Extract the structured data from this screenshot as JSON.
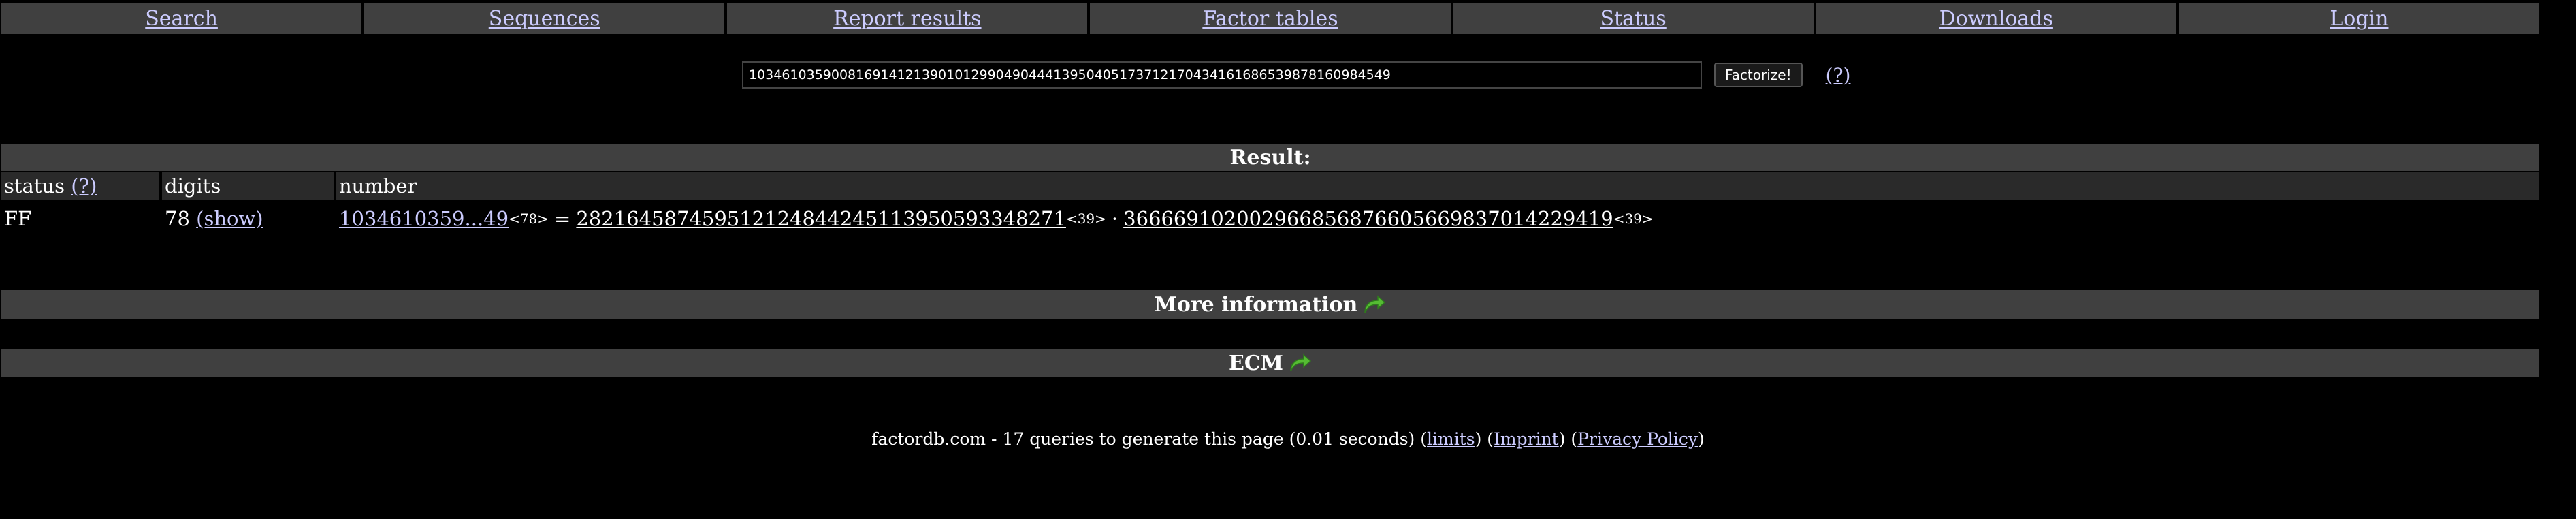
{
  "nav": {
    "items": [
      {
        "label": "Search"
      },
      {
        "label": "Sequences"
      },
      {
        "label": "Report results"
      },
      {
        "label": "Factor tables"
      },
      {
        "label": "Status"
      },
      {
        "label": "Downloads"
      },
      {
        "label": "Login"
      }
    ]
  },
  "search": {
    "value": "1034610359008169141213901012990490444139504051737121704341616865398781609845​49",
    "button_label": "Factorize!",
    "help_label": "(?)"
  },
  "result": {
    "header": "Result:",
    "columns": {
      "status": "status",
      "status_help": "(?)",
      "digits": "digits",
      "number": "number"
    },
    "row": {
      "status": "FF",
      "digits": "78",
      "show_label": "(show)",
      "number_short": "1034610359...49",
      "number_size": "<78>",
      "equals": "=",
      "factor1": "282164587459512124844245113950593348271",
      "factor1_size": "<39>",
      "times": "·",
      "factor2": "366669102002966856876605669837014229419",
      "factor2_size": "<39>"
    }
  },
  "sections": {
    "more_info": "More information",
    "ecm": "ECM"
  },
  "footer": {
    "text": "factordb.com - 17 queries to generate this page (0.01 seconds)",
    "limits": "limits",
    "imprint": "Imprint",
    "privacy": "Privacy Policy"
  },
  "colors": {
    "background": "#000000",
    "bar": "#404040",
    "link": "#ccccff",
    "arrow": "#55bb33"
  }
}
